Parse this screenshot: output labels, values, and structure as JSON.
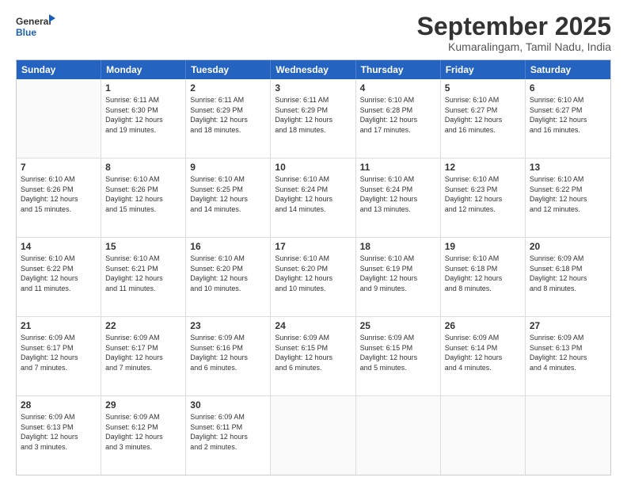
{
  "header": {
    "logo_line1": "General",
    "logo_line2": "Blue",
    "main_title": "September 2025",
    "subtitle": "Kumaralingam, Tamil Nadu, India"
  },
  "calendar": {
    "days_of_week": [
      "Sunday",
      "Monday",
      "Tuesday",
      "Wednesday",
      "Thursday",
      "Friday",
      "Saturday"
    ],
    "rows": [
      [
        {
          "day": "",
          "info": ""
        },
        {
          "day": "1",
          "info": "Sunrise: 6:11 AM\nSunset: 6:30 PM\nDaylight: 12 hours\nand 19 minutes."
        },
        {
          "day": "2",
          "info": "Sunrise: 6:11 AM\nSunset: 6:29 PM\nDaylight: 12 hours\nand 18 minutes."
        },
        {
          "day": "3",
          "info": "Sunrise: 6:11 AM\nSunset: 6:29 PM\nDaylight: 12 hours\nand 18 minutes."
        },
        {
          "day": "4",
          "info": "Sunrise: 6:10 AM\nSunset: 6:28 PM\nDaylight: 12 hours\nand 17 minutes."
        },
        {
          "day": "5",
          "info": "Sunrise: 6:10 AM\nSunset: 6:27 PM\nDaylight: 12 hours\nand 16 minutes."
        },
        {
          "day": "6",
          "info": "Sunrise: 6:10 AM\nSunset: 6:27 PM\nDaylight: 12 hours\nand 16 minutes."
        }
      ],
      [
        {
          "day": "7",
          "info": "Sunrise: 6:10 AM\nSunset: 6:26 PM\nDaylight: 12 hours\nand 15 minutes."
        },
        {
          "day": "8",
          "info": "Sunrise: 6:10 AM\nSunset: 6:26 PM\nDaylight: 12 hours\nand 15 minutes."
        },
        {
          "day": "9",
          "info": "Sunrise: 6:10 AM\nSunset: 6:25 PM\nDaylight: 12 hours\nand 14 minutes."
        },
        {
          "day": "10",
          "info": "Sunrise: 6:10 AM\nSunset: 6:24 PM\nDaylight: 12 hours\nand 14 minutes."
        },
        {
          "day": "11",
          "info": "Sunrise: 6:10 AM\nSunset: 6:24 PM\nDaylight: 12 hours\nand 13 minutes."
        },
        {
          "day": "12",
          "info": "Sunrise: 6:10 AM\nSunset: 6:23 PM\nDaylight: 12 hours\nand 12 minutes."
        },
        {
          "day": "13",
          "info": "Sunrise: 6:10 AM\nSunset: 6:22 PM\nDaylight: 12 hours\nand 12 minutes."
        }
      ],
      [
        {
          "day": "14",
          "info": "Sunrise: 6:10 AM\nSunset: 6:22 PM\nDaylight: 12 hours\nand 11 minutes."
        },
        {
          "day": "15",
          "info": "Sunrise: 6:10 AM\nSunset: 6:21 PM\nDaylight: 12 hours\nand 11 minutes."
        },
        {
          "day": "16",
          "info": "Sunrise: 6:10 AM\nSunset: 6:20 PM\nDaylight: 12 hours\nand 10 minutes."
        },
        {
          "day": "17",
          "info": "Sunrise: 6:10 AM\nSunset: 6:20 PM\nDaylight: 12 hours\nand 10 minutes."
        },
        {
          "day": "18",
          "info": "Sunrise: 6:10 AM\nSunset: 6:19 PM\nDaylight: 12 hours\nand 9 minutes."
        },
        {
          "day": "19",
          "info": "Sunrise: 6:10 AM\nSunset: 6:18 PM\nDaylight: 12 hours\nand 8 minutes."
        },
        {
          "day": "20",
          "info": "Sunrise: 6:09 AM\nSunset: 6:18 PM\nDaylight: 12 hours\nand 8 minutes."
        }
      ],
      [
        {
          "day": "21",
          "info": "Sunrise: 6:09 AM\nSunset: 6:17 PM\nDaylight: 12 hours\nand 7 minutes."
        },
        {
          "day": "22",
          "info": "Sunrise: 6:09 AM\nSunset: 6:17 PM\nDaylight: 12 hours\nand 7 minutes."
        },
        {
          "day": "23",
          "info": "Sunrise: 6:09 AM\nSunset: 6:16 PM\nDaylight: 12 hours\nand 6 minutes."
        },
        {
          "day": "24",
          "info": "Sunrise: 6:09 AM\nSunset: 6:15 PM\nDaylight: 12 hours\nand 6 minutes."
        },
        {
          "day": "25",
          "info": "Sunrise: 6:09 AM\nSunset: 6:15 PM\nDaylight: 12 hours\nand 5 minutes."
        },
        {
          "day": "26",
          "info": "Sunrise: 6:09 AM\nSunset: 6:14 PM\nDaylight: 12 hours\nand 4 minutes."
        },
        {
          "day": "27",
          "info": "Sunrise: 6:09 AM\nSunset: 6:13 PM\nDaylight: 12 hours\nand 4 minutes."
        }
      ],
      [
        {
          "day": "28",
          "info": "Sunrise: 6:09 AM\nSunset: 6:13 PM\nDaylight: 12 hours\nand 3 minutes."
        },
        {
          "day": "29",
          "info": "Sunrise: 6:09 AM\nSunset: 6:12 PM\nDaylight: 12 hours\nand 3 minutes."
        },
        {
          "day": "30",
          "info": "Sunrise: 6:09 AM\nSunset: 6:11 PM\nDaylight: 12 hours\nand 2 minutes."
        },
        {
          "day": "",
          "info": ""
        },
        {
          "day": "",
          "info": ""
        },
        {
          "day": "",
          "info": ""
        },
        {
          "day": "",
          "info": ""
        }
      ]
    ]
  }
}
